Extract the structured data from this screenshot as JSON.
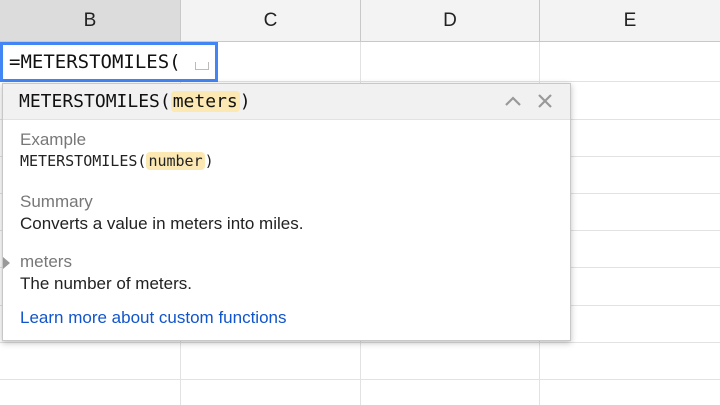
{
  "columns": [
    "B",
    "C",
    "D",
    "E"
  ],
  "active_cell": {
    "formula": "=METERSTOMILES("
  },
  "tooltip": {
    "signature_prefix": "METERSTOMILES(",
    "signature_param": "meters",
    "signature_suffix": ")",
    "example_label": "Example",
    "example_prefix": "METERSTOMILES(",
    "example_param": "number",
    "example_suffix": ")",
    "summary_label": "Summary",
    "summary_text": "Converts a value in meters into miles.",
    "param_name": "meters",
    "param_desc": "The number of meters.",
    "learn_more": "Learn more about custom functions"
  },
  "icons": {
    "collapse": "chevron-up-icon",
    "close": "close-icon"
  },
  "colors": {
    "active_border": "#4285f4",
    "param_highlight": "#fce8b2",
    "link": "#1155cc"
  }
}
